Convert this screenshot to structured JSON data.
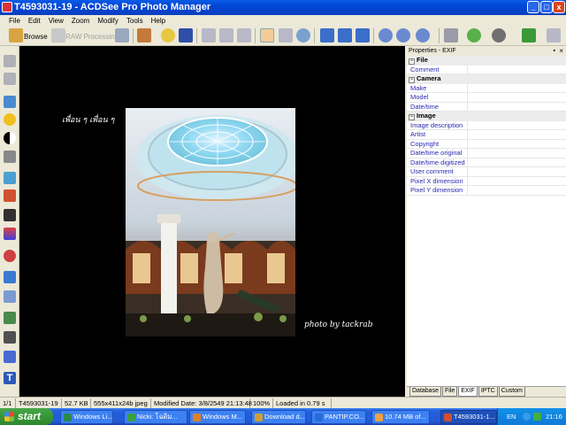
{
  "window": {
    "title": "T4593031-19 - ACDSee Pro Photo Manager",
    "minimize": "_",
    "maximize": "□",
    "close": "x"
  },
  "menu": [
    "File",
    "Edit",
    "View",
    "Zoom",
    "Modify",
    "Tools",
    "Help"
  ],
  "toolbar": {
    "browse_label": "Browse",
    "raw_label": "RAW Processing"
  },
  "viewer": {
    "signature_top": "เพื่อน ๆ เพื่อน ๆ",
    "signature_bottom": "photo by tackrab"
  },
  "properties": {
    "header": "Properties - EXIF",
    "sections": [
      {
        "title": "File",
        "rows": [
          "Comment"
        ]
      },
      {
        "title": "Camera",
        "rows": [
          "Make",
          "Model",
          "Date/time"
        ]
      },
      {
        "title": "Image",
        "rows": [
          "Image description",
          "Artist",
          "Copyright",
          "Date/time original",
          "Date/time digitized",
          "User comment",
          "Pixel X dimension",
          "Pixel Y dimension"
        ]
      }
    ],
    "tabs": [
      "Database",
      "File",
      "EXIF",
      "IPTC",
      "Custom"
    ],
    "active_tab": "EXIF"
  },
  "status": {
    "index": "1/1",
    "filename": "T4593031-19",
    "size": "52.7 KB",
    "dims": "555x411x24b jpeg",
    "modified": "Modified Date: 3/8/2549 21:13:48",
    "zoom": "100%",
    "loaded": "Loaded in 0.79 s"
  },
  "taskbar": {
    "start": "start",
    "tasks": [
      "Windows Li...",
      "Nicki: โฉดิม...",
      "Windows M...",
      "Download d...",
      "PANTIP.CO...",
      "10.74 MB of...",
      "T4593031-1..."
    ],
    "lang": "EN",
    "time": "21:16"
  },
  "colors": {
    "title_blue": "#0a5ce6",
    "chrome": "#ece9d8",
    "link_blue": "#2a2ab0",
    "start_green": "#379a37"
  }
}
